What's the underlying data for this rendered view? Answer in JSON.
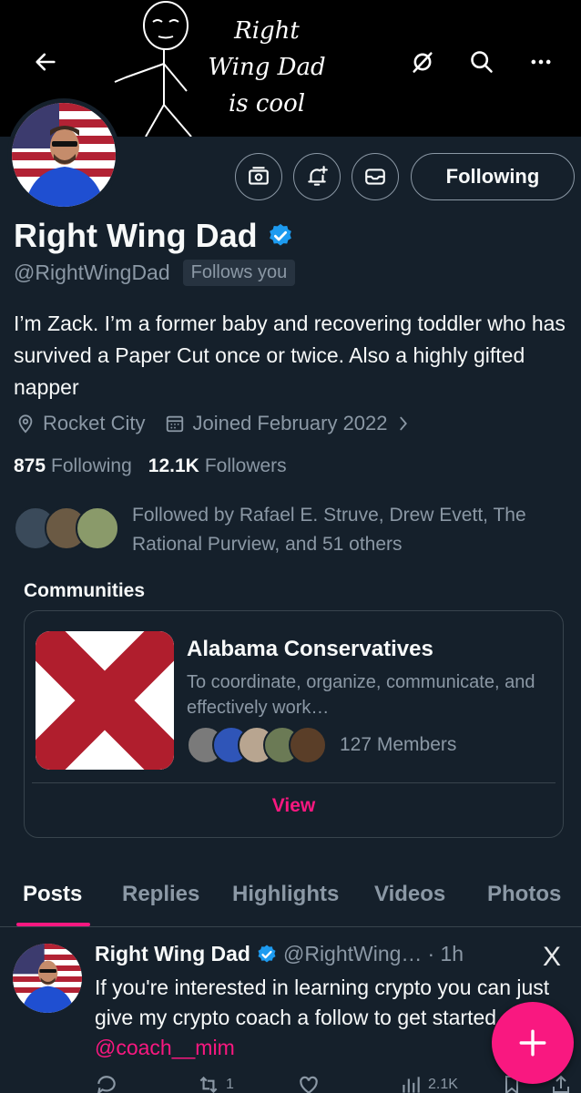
{
  "banner": {
    "text_lines": [
      "Right",
      "Wing Dad",
      "is cool"
    ]
  },
  "profile": {
    "display_name": "Right Wing Dad",
    "handle": "@RightWingDad",
    "follows_you": "Follows you",
    "following_button": "Following",
    "bio": "I’m Zack. I’m a former baby and recovering toddler who has survived a Paper Cut once or twice. Also a highly gifted napper",
    "location": "Rocket City",
    "joined": "Joined February 2022",
    "following_count": "875",
    "following_label": "Following",
    "followers_count": "12.1K",
    "followers_label": "Followers",
    "followed_by": "Followed by Rafael E. Struve, Drew Evett, The Rational Purview, and 51 others"
  },
  "communities": {
    "label": "Communities",
    "card": {
      "name": "Alabama Conservatives",
      "description": "To coordinate, organize, communicate, and effectively work…",
      "members": "127 Members",
      "view_label": "View"
    }
  },
  "tabs": [
    {
      "label": "Posts"
    },
    {
      "label": "Replies"
    },
    {
      "label": "Highlights"
    },
    {
      "label": "Videos"
    },
    {
      "label": "Photos"
    }
  ],
  "post": {
    "name": "Right Wing Dad",
    "handle": "@RightWing…",
    "time": "· 1h",
    "x_logo": "X",
    "text": "If you're interested in learning crypto you can just give my crypto coach a follow to get started ",
    "mention": "@coach__mim",
    "reposts": "1",
    "views": "2.1K"
  },
  "colors": {
    "background": "#15202b",
    "accent": "#f91880",
    "verified": "#1d9bf0",
    "muted": "#8b98a5"
  }
}
